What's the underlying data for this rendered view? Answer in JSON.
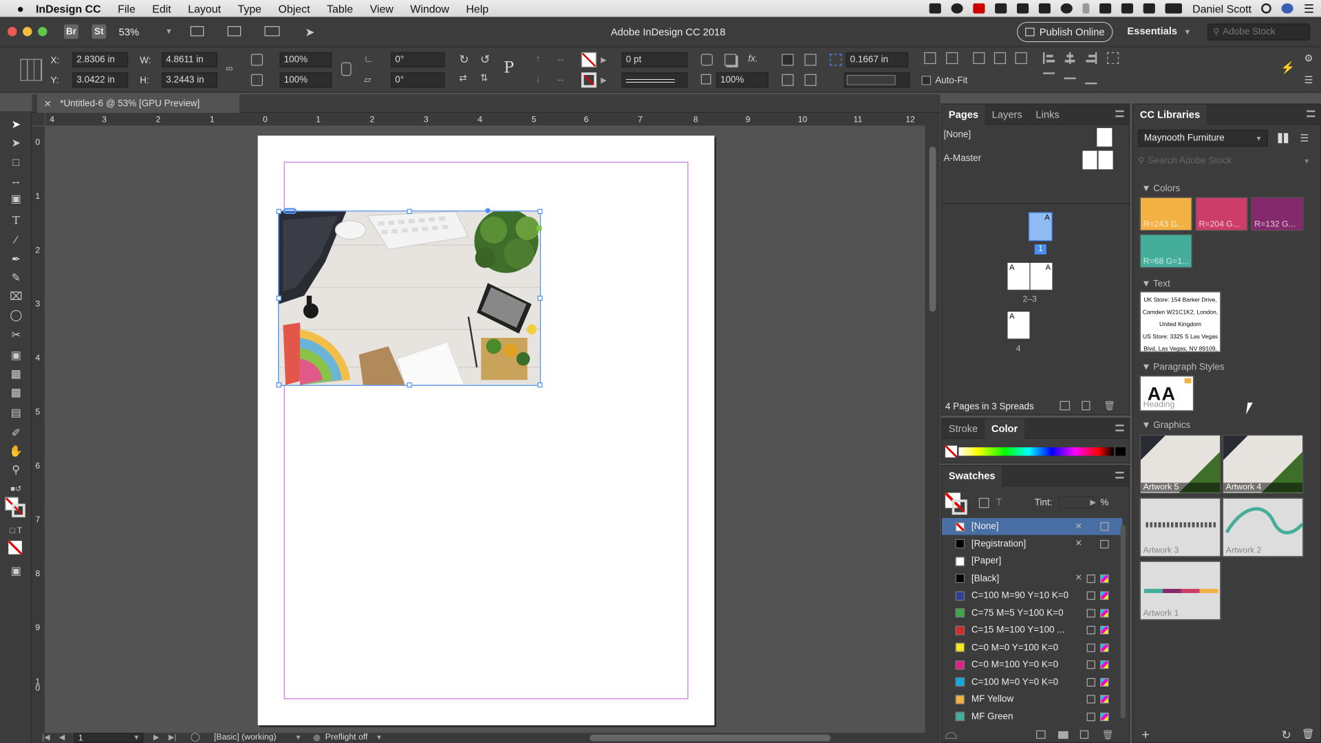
{
  "menubar": {
    "app": "InDesign CC",
    "items": [
      "File",
      "Edit",
      "Layout",
      "Type",
      "Object",
      "Table",
      "View",
      "Window",
      "Help"
    ],
    "user": "Daniel Scott"
  },
  "appbar": {
    "title": "Adobe InDesign CC 2018",
    "zoom": "53%",
    "br": "Br",
    "st": "St",
    "publish": "Publish Online",
    "workspace": "Essentials",
    "stock_placeholder": "Adobe Stock"
  },
  "control": {
    "x_label": "X:",
    "x": "2.8306 in",
    "y_label": "Y:",
    "y": "3.0422 in",
    "w_label": "W:",
    "w": "4.8611 in",
    "h_label": "H:",
    "h": "3.2443 in",
    "scale_x": "100%",
    "scale_y": "100%",
    "rotate": "0°",
    "shear": "0°",
    "stroke_weight": "0 pt",
    "opacity": "100%",
    "fit_offset": "0.1667 in",
    "autofit": "Auto-Fit"
  },
  "document": {
    "tab": "*Untitled-6 @ 53% [GPU Preview]",
    "hruler": [
      "4",
      "3",
      "2",
      "1",
      "0",
      "1",
      "2",
      "3",
      "4",
      "5",
      "6",
      "7",
      "8",
      "9",
      "10",
      "11",
      "12"
    ],
    "vruler": [
      "0",
      "1",
      "2",
      "3",
      "4",
      "5",
      "6",
      "7",
      "8",
      "9",
      "1\n0"
    ]
  },
  "status": {
    "page": "1",
    "style": "[Basic] (working)",
    "preflight": "Preflight off"
  },
  "pages_panel": {
    "tabs": [
      "Pages",
      "Layers",
      "Links"
    ],
    "none": "[None]",
    "master": "A-Master",
    "p1": "1",
    "p23": "2–3",
    "p4": "4",
    "a": "A",
    "summary": "4 Pages in 3 Spreads"
  },
  "color_panel": {
    "tabs": [
      "Stroke",
      "Color"
    ]
  },
  "swatches": {
    "title": "Swatches",
    "tint": "Tint:",
    "pct": "%",
    "t": "T",
    "items": [
      {
        "name": "[None]",
        "color": "none"
      },
      {
        "name": "[Registration]",
        "color": "#000000"
      },
      {
        "name": "[Paper]",
        "color": "#ffffff"
      },
      {
        "name": "[Black]",
        "color": "#000000"
      },
      {
        "name": "C=100 M=90 Y=10 K=0",
        "color": "#2e3f96"
      },
      {
        "name": "C=75 M=5 Y=100 K=0",
        "color": "#3fa846"
      },
      {
        "name": "C=15 M=100 Y=100 ...",
        "color": "#d42a2a"
      },
      {
        "name": "C=0 M=0 Y=100 K=0",
        "color": "#f7ea1a"
      },
      {
        "name": "C=0 M=100 Y=0 K=0",
        "color": "#e0218a"
      },
      {
        "name": "C=100 M=0 Y=0 K=0",
        "color": "#12a8e0"
      },
      {
        "name": "MF Yellow",
        "color": "#f3b143"
      },
      {
        "name": "MF Green",
        "color": "#44ae9a"
      }
    ]
  },
  "libraries": {
    "title": "CC Libraries",
    "library": "Maynooth Furniture",
    "search_placeholder": "Search Adobe Stock",
    "colors_label": "Colors",
    "colors": [
      {
        "label": "R=243 G...",
        "hex": "#f3b143"
      },
      {
        "label": "R=204 G...",
        "hex": "#cc3d6a"
      },
      {
        "label": "R=132 G...",
        "hex": "#842a6c"
      },
      {
        "label": "R=68 G=1...",
        "hex": "#44ae9a"
      }
    ],
    "text_label": "Text",
    "text_lines": [
      "UK Store: 154 Barker Drive,",
      "Camden W21C1K2, London,",
      "United Kingdom",
      "US Store: 3325 S Las Vegas",
      "Blvd, Las Vegas, NV 89109,"
    ],
    "para_label": "Paragraph Styles",
    "para_sample": "AA",
    "para_name": "Heading",
    "graphics_label": "Graphics",
    "artworks": [
      "Artwork 5",
      "Artwork 4",
      "Artwork 3",
      "Artwork 2",
      "Artwork 1"
    ]
  }
}
